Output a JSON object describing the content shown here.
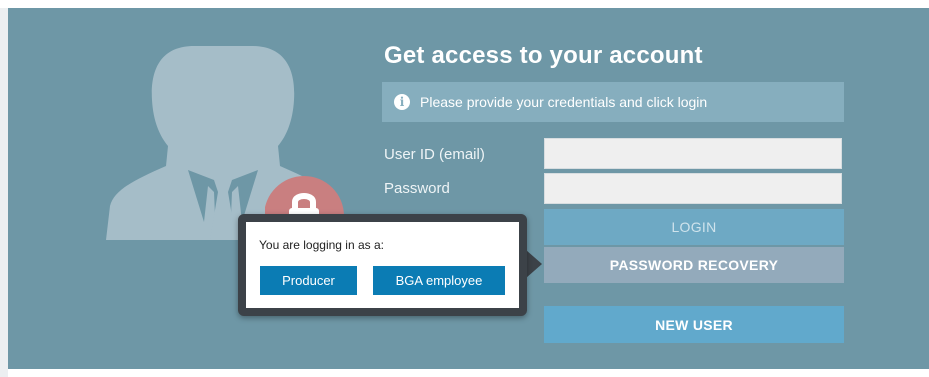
{
  "login": {
    "title": "Get access to your account",
    "info_message": "Please provide your credentials and click login",
    "user_id_label": "User ID (email)",
    "user_id_value": "",
    "password_label": "Password",
    "password_value": "",
    "login_button": "LOGIN",
    "password_recovery_button": "PASSWORD RECOVERY",
    "new_user_button": "NEW USER"
  },
  "popover": {
    "prompt": "You are logging in as a:",
    "producer_button": "Producer",
    "bga_employee_button": "BGA employee"
  },
  "icons": {
    "avatar": "user-avatar-icon",
    "lock": "lock-icon",
    "info": "info-icon"
  },
  "colors": {
    "panel_bg": "#6e97a6",
    "info_bar_bg": "#86aebe",
    "login_btn": "#6ea9c4",
    "recovery_btn": "#93aabb",
    "new_user_btn": "#61a9cc",
    "popover_btn": "#0b7cb4",
    "popover_border": "#3c4248",
    "lock_red": "#c97f80"
  }
}
